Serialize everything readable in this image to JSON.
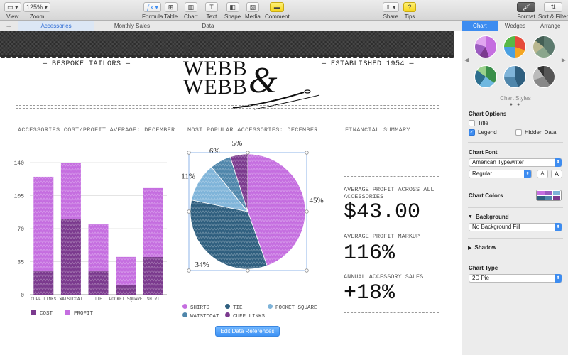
{
  "toolbar": {
    "view": "View",
    "zoom_value": "125%",
    "zoom": "Zoom",
    "formula": "Formula",
    "table": "Table",
    "chart": "Chart",
    "text": "Text",
    "shape": "Shape",
    "media": "Media",
    "comment": "Comment",
    "share": "Share",
    "tips": "Tips",
    "format": "Format",
    "sort_filter": "Sort & Filter"
  },
  "sheet_tabs": [
    "Accessories",
    "Monthly Sales",
    "Data"
  ],
  "header": {
    "left_tag": "— BESPOKE TAILORS —",
    "right_tag": "— ESTABLISHED 1954 —",
    "logo_line1": "WEBB",
    "logo_line2": "WEBB",
    "logo_amp": "&"
  },
  "sections": {
    "bar_title": "ACCESSORIES COST/PROFIT AVERAGE: DECEMBER",
    "pie_title": "MOST POPULAR ACCESSORIES: DECEMBER",
    "summary_title": "FINANCIAL SUMMARY"
  },
  "summary": {
    "items": [
      {
        "label": "AVERAGE PROFIT ACROSS ALL ACCESSORIES",
        "value": "$43.00"
      },
      {
        "label": "AVERAGE PROFIT MARKUP",
        "value": "116%"
      },
      {
        "label": "ANNUAL ACCESSORY SALES",
        "value": "+18%"
      }
    ]
  },
  "edit_button": "Edit Data References",
  "chart_data": [
    {
      "type": "bar",
      "title": "ACCESSORIES COST/PROFIT AVERAGE: DECEMBER",
      "categories": [
        "CUFF LINKS",
        "WAISTCOAT",
        "TIE",
        "POCKET SQUARE",
        "SHIRT"
      ],
      "series": [
        {
          "name": "COST",
          "values": [
            25,
            80,
            25,
            10,
            40
          ],
          "color": "#7b3a8e"
        },
        {
          "name": "PROFIT",
          "values": [
            100,
            60,
            50,
            30,
            73
          ],
          "color": "#c56ee0"
        }
      ],
      "stacked": true,
      "ylim": [
        0,
        140
      ],
      "yticks": [
        0,
        35,
        70,
        105,
        140
      ],
      "legend": "bottom-left",
      "grid": true
    },
    {
      "type": "pie",
      "title": "MOST POPULAR ACCESSORIES: DECEMBER",
      "slices": [
        {
          "name": "SHIRTS",
          "value": 45,
          "label": "45%",
          "color": "#c56ee0"
        },
        {
          "name": "TIE",
          "value": 34,
          "label": "34%",
          "color": "#2f5f7f"
        },
        {
          "name": "POCKET SQUARE",
          "value": 11,
          "label": "11%",
          "color": "#7fb4d9"
        },
        {
          "name": "WAISTCOAT",
          "value": 6,
          "label": "6%",
          "color": "#4f86ab"
        },
        {
          "name": "CUFF LINKS",
          "value": 5,
          "label": "5%",
          "color": "#7b3a8e"
        }
      ],
      "legend": "bottom"
    }
  ],
  "sidebar": {
    "tabs": [
      "Chart",
      "Wedges",
      "Arrange"
    ],
    "styles_caption": "Chart Styles",
    "chart_options": "Chart Options",
    "title_opt": "Title",
    "legend_opt": "Legend",
    "hidden_data_opt": "Hidden Data",
    "chart_font": "Chart Font",
    "font_name": "American Typewriter",
    "font_style": "Regular",
    "font_small": "A",
    "font_large": "A",
    "chart_colors": "Chart Colors",
    "background": "Background",
    "background_value": "No Background Fill",
    "shadow": "Shadow",
    "chart_type": "Chart Type",
    "chart_type_value": "2D Pie"
  }
}
